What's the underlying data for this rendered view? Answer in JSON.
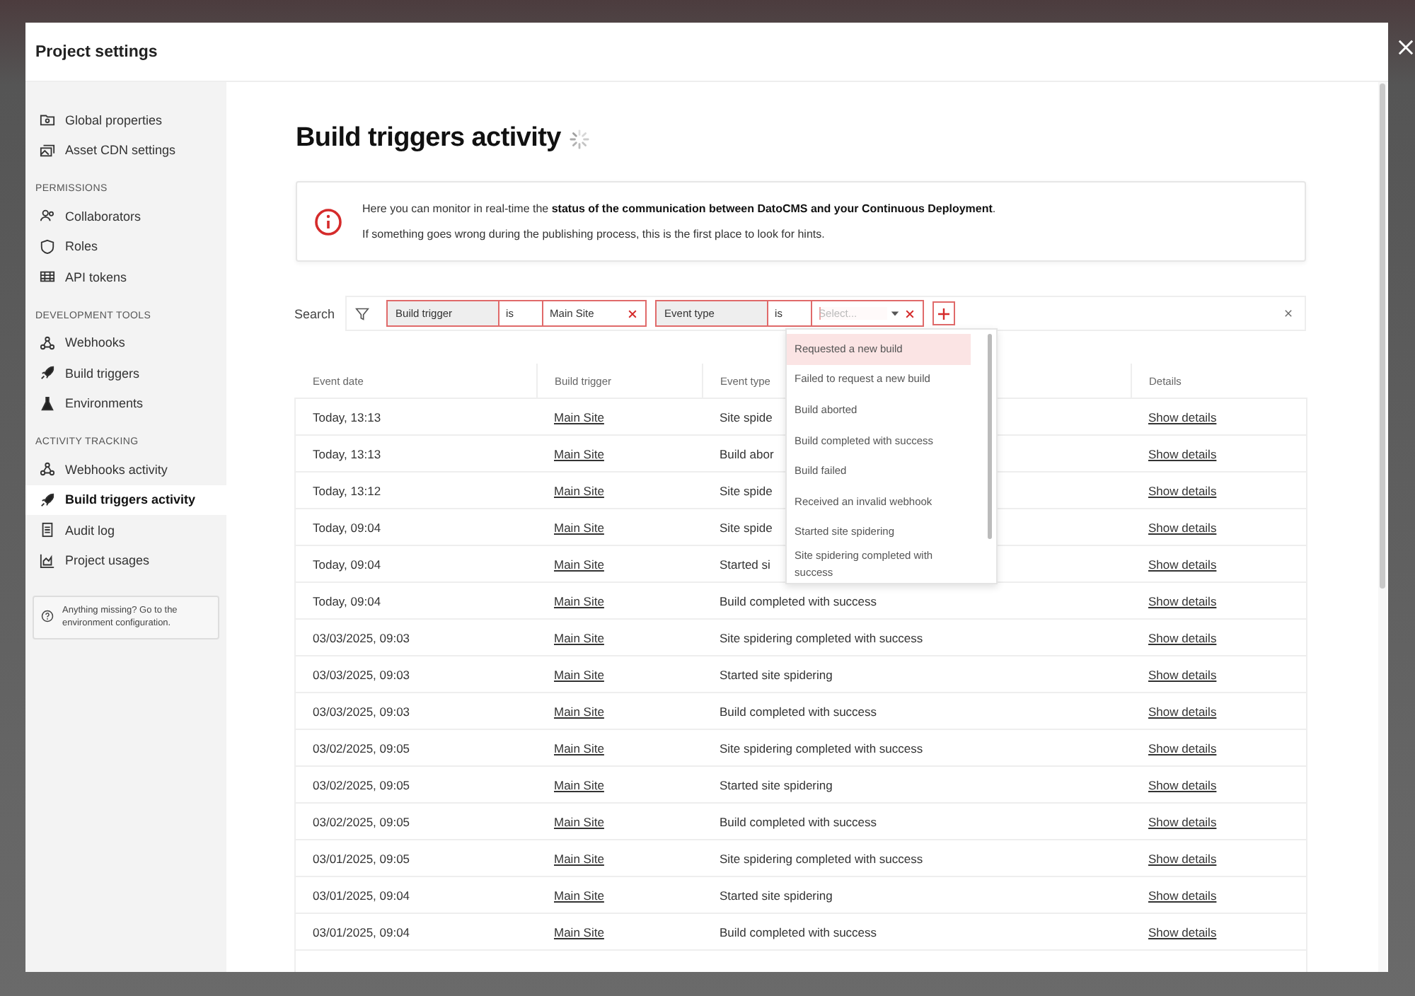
{
  "window": {
    "title": "Project settings"
  },
  "sidebar": {
    "groups": [
      {
        "items": [
          {
            "label": "Global properties",
            "selected": false
          },
          {
            "label": "Asset CDN settings",
            "selected": false
          }
        ]
      },
      {
        "heading": "PERMISSIONS",
        "items": [
          {
            "label": "Collaborators",
            "selected": false
          },
          {
            "label": "Roles",
            "selected": false
          },
          {
            "label": "API tokens",
            "selected": false
          }
        ]
      },
      {
        "heading": "DEVELOPMENT TOOLS",
        "items": [
          {
            "label": "Webhooks",
            "selected": false
          },
          {
            "label": "Build triggers",
            "selected": false
          },
          {
            "label": "Environments",
            "selected": false
          }
        ]
      },
      {
        "heading": "ACTIVITY TRACKING",
        "items": [
          {
            "label": "Webhooks activity",
            "selected": false
          },
          {
            "label": "Build triggers activity",
            "selected": true
          },
          {
            "label": "Audit log",
            "selected": false
          },
          {
            "label": "Project usages",
            "selected": false
          }
        ]
      }
    ],
    "hint": "Anything missing? Go to the environment configuration."
  },
  "page": {
    "title": "Build triggers activity",
    "loading": true
  },
  "notice": {
    "lines": [
      "Here you can monitor in real-time the **status of the communication between DatoCMS and your Continuous Deployment**.",
      "If something goes wrong during the publishing process, this is the first place to look for hints."
    ]
  },
  "search": {
    "label": "Search",
    "filters": [
      {
        "field": "Build trigger",
        "operator": "is",
        "value": "Main Site",
        "open": false
      },
      {
        "field": "Event type",
        "operator": "is",
        "placeholder": "Select...",
        "open": true
      }
    ]
  },
  "dropdown": {
    "options": [
      {
        "label": "Requested a new build",
        "selected": true
      },
      {
        "label": "Failed to request a new build",
        "selected": false
      },
      {
        "label": "Build aborted",
        "selected": false
      },
      {
        "label": "Build completed with success",
        "selected": false
      },
      {
        "label": "Build failed",
        "selected": false
      },
      {
        "label": "Received an invalid webhook",
        "selected": false
      },
      {
        "label": "Started site spidering",
        "selected": false
      },
      {
        "label": "Site spidering completed with success",
        "selected": false
      }
    ]
  },
  "table": {
    "columns": [
      "Event date",
      "Build trigger",
      "Event type",
      "Details"
    ],
    "rows": [
      {
        "date": "Today, 13:13",
        "trigger": "Main Site",
        "event": "Site spide",
        "details": "Show details"
      },
      {
        "date": "Today, 13:13",
        "trigger": "Main Site",
        "event": "Build abor",
        "details": "Show details"
      },
      {
        "date": "Today, 13:12",
        "trigger": "Main Site",
        "event": "Site spide",
        "details": "Show details"
      },
      {
        "date": "Today, 09:04",
        "trigger": "Main Site",
        "event": "Site spide",
        "details": "Show details"
      },
      {
        "date": "Today, 09:04",
        "trigger": "Main Site",
        "event": "Started si",
        "details": "Show details"
      },
      {
        "date": "Today, 09:04",
        "trigger": "Main Site",
        "event": "Build completed with success",
        "details": "Show details"
      },
      {
        "date": "03/03/2025, 09:03",
        "trigger": "Main Site",
        "event": "Site spidering completed with success",
        "details": "Show details"
      },
      {
        "date": "03/03/2025, 09:03",
        "trigger": "Main Site",
        "event": "Started site spidering",
        "details": "Show details"
      },
      {
        "date": "03/03/2025, 09:03",
        "trigger": "Main Site",
        "event": "Build completed with success",
        "details": "Show details"
      },
      {
        "date": "03/02/2025, 09:05",
        "trigger": "Main Site",
        "event": "Site spidering completed with success",
        "details": "Show details"
      },
      {
        "date": "03/02/2025, 09:05",
        "trigger": "Main Site",
        "event": "Started site spidering",
        "details": "Show details"
      },
      {
        "date": "03/02/2025, 09:05",
        "trigger": "Main Site",
        "event": "Build completed with success",
        "details": "Show details"
      },
      {
        "date": "03/01/2025, 09:05",
        "trigger": "Main Site",
        "event": "Site spidering completed with success",
        "details": "Show details"
      },
      {
        "date": "03/01/2025, 09:04",
        "trigger": "Main Site",
        "event": "Started site spidering",
        "details": "Show details"
      },
      {
        "date": "03/01/2025, 09:04",
        "trigger": "Main Site",
        "event": "Build completed with success",
        "details": "Show details"
      }
    ]
  }
}
